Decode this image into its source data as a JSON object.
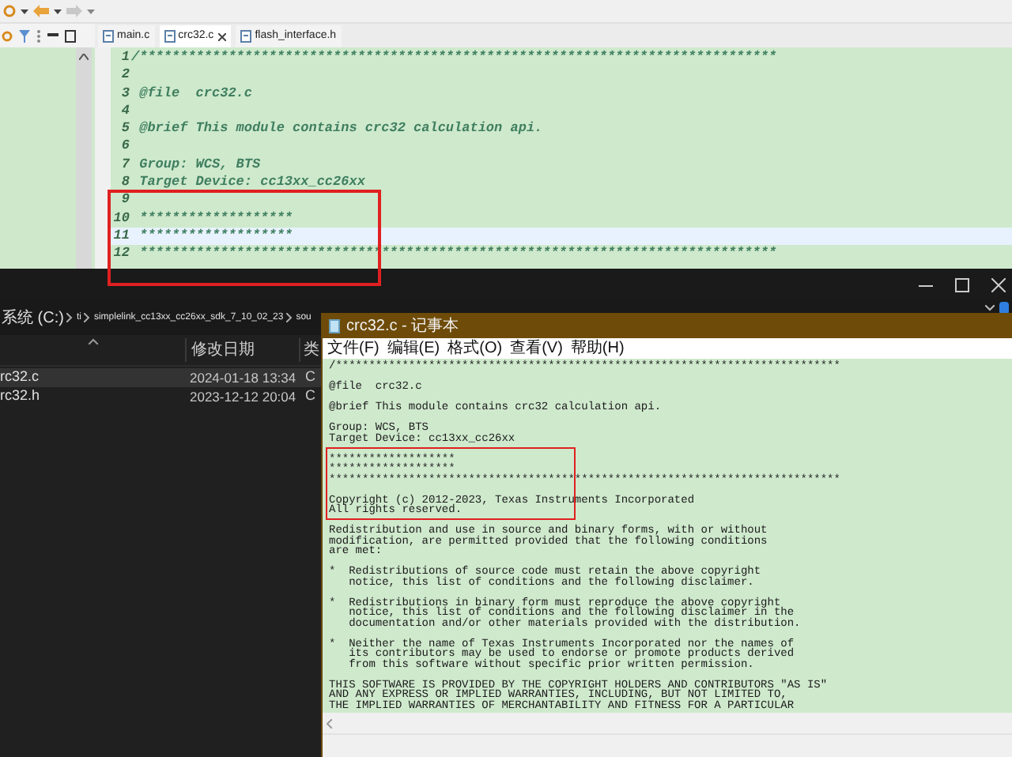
{
  "ide": {
    "tabs": [
      {
        "label": "main.c",
        "selected": false,
        "closable": false
      },
      {
        "label": "crc32.c",
        "selected": true,
        "closable": true
      },
      {
        "label": "flash_interface.h",
        "selected": false,
        "closable": false
      }
    ],
    "lines": [
      {
        "number": "1",
        "text": "/*******************************************************************************",
        "current": false
      },
      {
        "number": "2",
        "current": false
      },
      {
        "number": "3",
        "text": " @file  crc32.c",
        "current": false
      },
      {
        "number": "4",
        "current": false
      },
      {
        "number": "5",
        "text": " @brief This module contains crc32 calculation api.",
        "current": false
      },
      {
        "number": "6",
        "current": false
      },
      {
        "number": "7",
        "text": " Group: WCS, BTS",
        "current": false
      },
      {
        "number": "8",
        "text": " Target Device: cc13xx_cc26xx",
        "current": false
      },
      {
        "number": "9",
        "current": false
      },
      {
        "number": "10",
        "text": " *******************",
        "current": false
      },
      {
        "number": "11",
        "text": " *******************",
        "current": true
      },
      {
        "number": "12",
        "text": " *******************************************************************************",
        "current": false
      }
    ]
  },
  "explorer": {
    "breadcrumb": [
      "系统 (C:)",
      "ti",
      "simplelink_cc13xx_cc26xx_sdk_7_10_02_23",
      "sou"
    ],
    "columns": [
      "修改日期",
      "类"
    ],
    "rows": [
      {
        "name": "rc32.c",
        "date": "2024-01-18 13:34",
        "type": "C",
        "selected": true
      },
      {
        "name": "rc32.h",
        "date": "2023-12-12 20:04",
        "type": "C",
        "selected": false
      }
    ]
  },
  "notepad": {
    "title": "crc32.c - 记事本",
    "menu": [
      "文件(F)",
      "编辑(E)",
      "格式(O)",
      "查看(V)",
      "帮助(H)"
    ],
    "blocks": [
      [
        "/****************************************************************************"
      ],
      [
        "@file  crc32.c"
      ],
      [
        "@brief This module contains crc32 calculation api."
      ],
      [
        "Group: WCS, BTS",
        "Target Device: cc13xx_cc26xx"
      ],
      [
        "*******************",
        "*******************",
        "*****************************************************************************"
      ],
      [
        "Copyright (c) 2012-2023, Texas Instruments Incorporated",
        "All rights reserved."
      ],
      [
        "Redistribution and use in source and binary forms, with or without",
        "modification, are permitted provided that the following conditions",
        "are met:"
      ],
      [
        "*  Redistributions of source code must retain the above copyright",
        "   notice, this list of conditions and the following disclaimer."
      ],
      [
        "*  Redistributions in binary form must reproduce the above copyright",
        "   notice, this list of conditions and the following disclaimer in the",
        "   documentation and/or other materials provided with the distribution."
      ],
      [
        "*  Neither the name of Texas Instruments Incorporated nor the names of",
        "   its contributors may be used to endorse or promote products derived",
        "   from this software without specific prior written permission."
      ],
      [
        "THIS SOFTWARE IS PROVIDED BY THE COPYRIGHT HOLDERS AND CONTRIBUTORS \"AS IS\"",
        "AND ANY EXPRESS OR IMPLIED WARRANTIES, INCLUDING, BUT NOT LIMITED TO,",
        "THE IMPLIED WARRANTIES OF MERCHANTABILITY AND FITNESS FOR A PARTICULAR"
      ]
    ]
  }
}
